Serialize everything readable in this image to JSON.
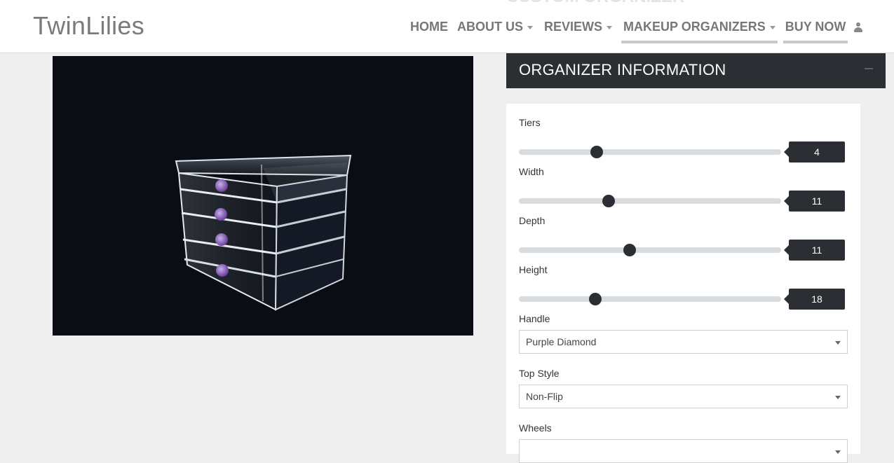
{
  "header": {
    "brand": "TwinLilies",
    "ghost_title": "CUSTOM ORGANIZER",
    "nav": [
      {
        "label": "HOME"
      },
      {
        "label": "ABOUT US"
      },
      {
        "label": "REVIEWS"
      },
      {
        "label": "MAKEUP ORGANIZERS"
      },
      {
        "label": "BUY NOW"
      }
    ]
  },
  "product": {
    "handle_color": "#7b5aa6"
  },
  "panel": {
    "title": "ORGANIZER INFORMATION"
  },
  "form": {
    "sliders": [
      {
        "label": "Tiers",
        "value": "4",
        "fill": 0.3
      },
      {
        "label": "Width",
        "value": "11",
        "fill": 0.345
      },
      {
        "label": "Depth",
        "value": "11",
        "fill": 0.425
      },
      {
        "label": "Height",
        "value": "18",
        "fill": 0.29
      }
    ],
    "handle": {
      "label": "Handle",
      "value": "Purple Diamond"
    },
    "top_style": {
      "label": "Top Style",
      "value": "Non-Flip"
    },
    "wheels": {
      "label": "Wheels"
    }
  },
  "colors": {
    "dark": "#2b2f33",
    "accent_text": "#777777"
  }
}
